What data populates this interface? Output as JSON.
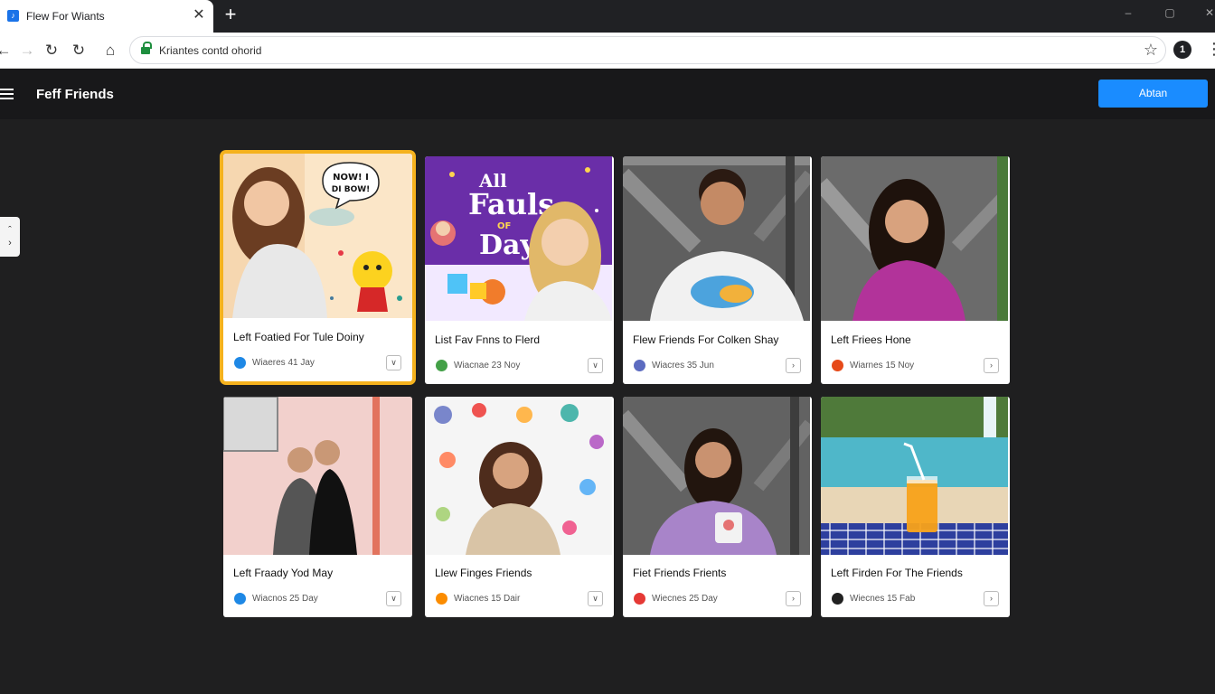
{
  "browser": {
    "tab_title": "Flew For Wiants",
    "tab_close": "✕",
    "new_tab": "+",
    "url": "Kriantes contd ohorid",
    "win_min": "–",
    "win_max": "▢",
    "win_close": "✕",
    "profile_initial": "1"
  },
  "app": {
    "title": "Feff Friends",
    "primary_button": "Abtan"
  },
  "cards": [
    {
      "title": "Left Foatied For Tule Doiny",
      "meta": "Wiaeres 41 Jay",
      "avatar_color": "#1e88e5",
      "selected": true
    },
    {
      "title": "List Fav Fnns to Flerd",
      "meta": "Wiacnae 23 Noy",
      "avatar_color": "#43a047",
      "selected": false
    },
    {
      "title": "Flew Friends For Colken Shay",
      "meta": "Wiacres 35 Jun",
      "avatar_color": "#5c6bc0",
      "selected": false
    },
    {
      "title": "Left Friees Hone",
      "meta": "Wiarnes 15 Noy",
      "avatar_color": "#e64a19",
      "selected": false
    },
    {
      "title": "Left Fraady Yod May",
      "meta": "Wiacnos 25 Day",
      "avatar_color": "#1e88e5",
      "selected": false
    },
    {
      "title": "Llew Finges Friends",
      "meta": "Wiacnes 15 Dair",
      "avatar_color": "#fb8c00",
      "selected": false
    },
    {
      "title": "Fiet Friends Frients",
      "meta": "Wiecnes 25 Day",
      "avatar_color": "#e53935",
      "selected": false
    },
    {
      "title": "Left Firden For The Friends",
      "meta": "Wiecnes 15 Fab",
      "avatar_color": "#212121",
      "selected": false
    }
  ],
  "art": {
    "poster_line1": "All",
    "poster_line2": "Fauls",
    "poster_line3": "OF",
    "poster_line4": "Day",
    "speech_line1": "NOW! I",
    "speech_line2": "DI BOW!"
  }
}
